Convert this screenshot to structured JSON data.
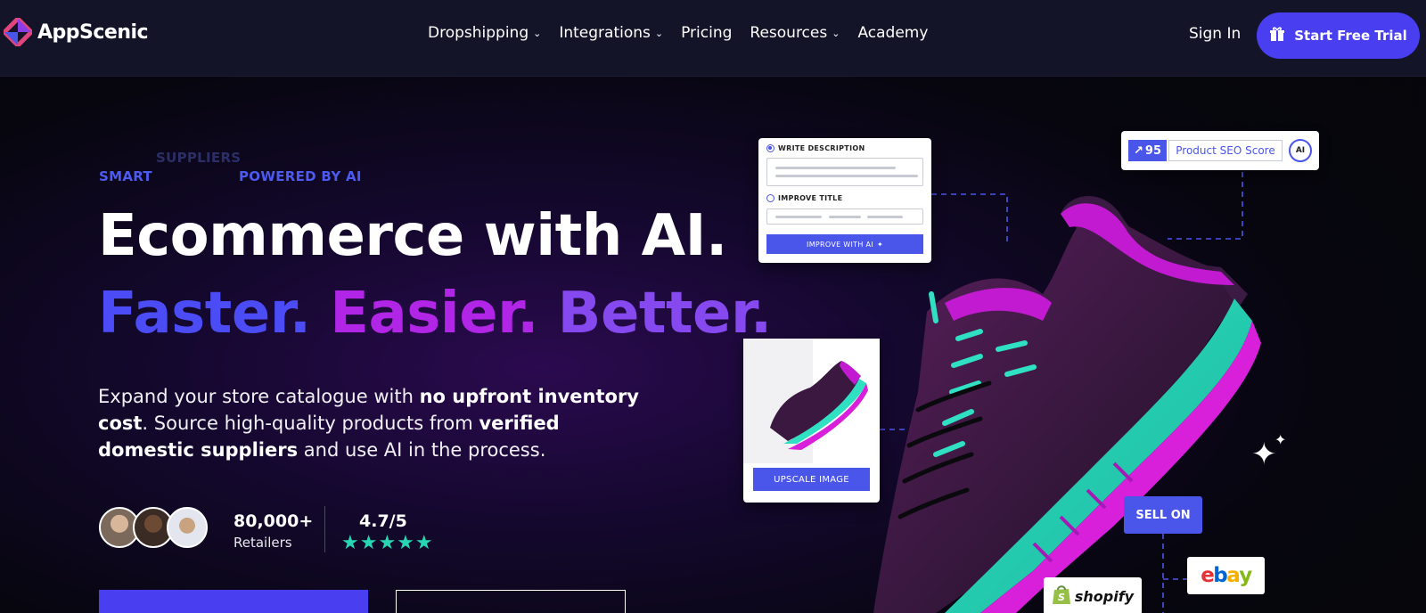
{
  "nav": {
    "brand": "AppScenic",
    "links": [
      {
        "label": "Dropshipping",
        "has_dropdown": true
      },
      {
        "label": "Integrations",
        "has_dropdown": true
      },
      {
        "label": "Pricing",
        "has_dropdown": false
      },
      {
        "label": "Resources",
        "has_dropdown": true
      },
      {
        "label": "Academy",
        "has_dropdown": false
      }
    ],
    "sign_in": "Sign In",
    "trial_button": "Start Free Trial"
  },
  "hero": {
    "eyebrow_1": "SMART",
    "eyebrow_2": "SUPPLIERS",
    "eyebrow_3": "POWERED BY AI",
    "headline": "Ecommerce with AI.",
    "tagline_1": "Faster.",
    "tagline_2": "Easier.",
    "tagline_3": "Better.",
    "description": {
      "p1": "Expand your store catalogue with ",
      "b1": "no upfront inventory cost",
      "p2": ". Source high-quality products from ",
      "b2": "verified domestic suppliers",
      "p3": " and use AI in the process."
    },
    "stats": {
      "retailers_value": "80,000+",
      "retailers_label": "Retailers",
      "rating_value": "4.7/5",
      "stars": "★★★★★"
    }
  },
  "visual": {
    "desc_card": {
      "write_description": "WRITE DESCRIPTION",
      "improve_title": "IMPROVE TITLE",
      "improve_button": "IMPROVE WITH AI"
    },
    "image_card": {
      "upscale_button": "UPSCALE IMAGE"
    },
    "seo": {
      "score": "95",
      "label": "Product SEO Score",
      "ai_badge": "AI"
    },
    "sell_on": "SELL ON",
    "ebay": "ebay",
    "shopify": "shopify"
  },
  "colors": {
    "accent": "#4a3ff0",
    "nav_bg": "#131427",
    "faster": "#4b4cf5",
    "easier": "#b125e6",
    "better": "#8649ef",
    "star": "#28d6b4"
  }
}
